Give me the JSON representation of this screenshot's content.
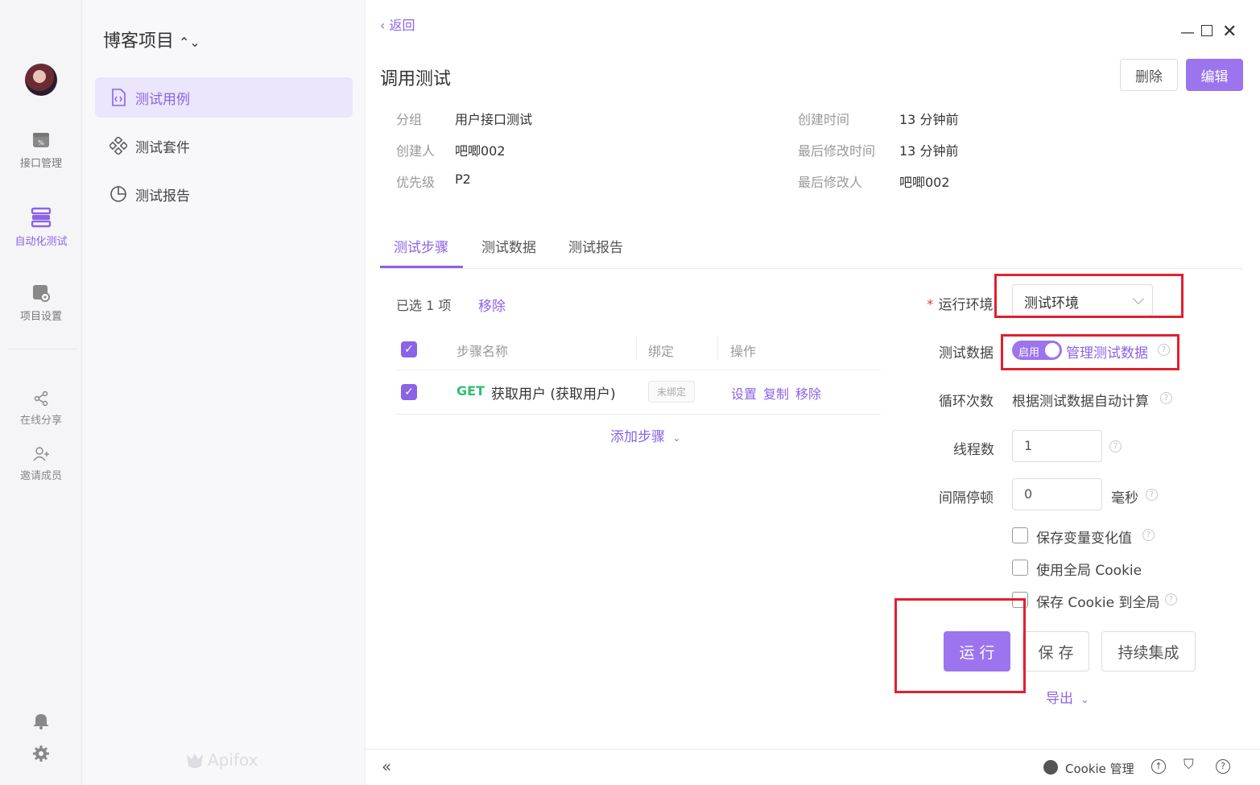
{
  "rail": {
    "items": [
      {
        "label": "接口管理"
      },
      {
        "label": "自动化测试"
      },
      {
        "label": "项目设置"
      }
    ],
    "share_label": "在线分享",
    "invite_label": "邀请成员"
  },
  "nav": {
    "project_title": "博客项目",
    "items": [
      {
        "label": "测试用例"
      },
      {
        "label": "测试套件"
      },
      {
        "label": "测试报告"
      }
    ],
    "brand": "Apifox"
  },
  "header": {
    "back_label": "返回",
    "title": "调用测试",
    "delete_label": "删除",
    "edit_label": "编辑"
  },
  "meta": {
    "group_key": "分组",
    "group_val": "用户接口测试",
    "creator_key": "创建人",
    "creator_val": "吧唧002",
    "priority_key": "优先级",
    "priority_val": "P2",
    "created_key": "创建时间",
    "created_val": "13 分钟前",
    "modified_key": "最后修改时间",
    "modified_val": "13 分钟前",
    "modifier_key": "最后修改人",
    "modifier_val": "吧唧002"
  },
  "tabs": [
    {
      "label": "测试步骤"
    },
    {
      "label": "测试数据"
    },
    {
      "label": "测试报告"
    }
  ],
  "steps": {
    "selected_text": "已选 1 项",
    "remove_label": "移除",
    "columns": [
      "步骤名称",
      "绑定",
      "操作"
    ],
    "rows": [
      {
        "method": "GET",
        "name": "获取用户 (获取用户)",
        "binding": "未绑定",
        "actions": [
          "设置",
          "复制",
          "移除"
        ]
      }
    ],
    "add_step_label": "添加步骤"
  },
  "form": {
    "env_label": "运行环境",
    "env_value": "测试环境",
    "data_label": "测试数据",
    "toggle_label": "启用",
    "manage_data_label": "管理测试数据",
    "loop_label": "循环次数",
    "loop_value": "根据测试数据自动计算",
    "threads_label": "线程数",
    "threads_value": "1",
    "interval_label": "间隔停顿",
    "interval_value": "0",
    "interval_unit": "毫秒",
    "checkboxes": [
      {
        "label": "保存变量变化值"
      },
      {
        "label": "使用全局 Cookie"
      },
      {
        "label": "保存 Cookie 到全局"
      }
    ],
    "run_label": "运 行",
    "save_label": "保 存",
    "ci_label": "持续集成",
    "export_label": "导出"
  },
  "footer": {
    "cookie_label": "Cookie 管理"
  },
  "colors": {
    "accent": "#8b63e6",
    "get_method": "#2fbf71",
    "highlight_box": "#e0202f"
  }
}
